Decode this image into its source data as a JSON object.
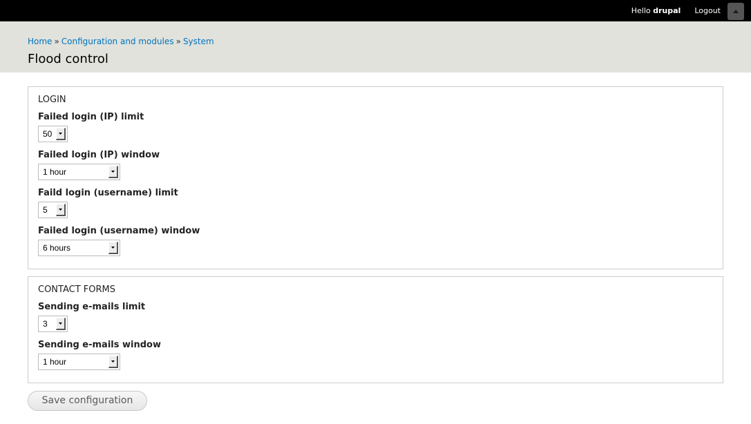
{
  "toolbar": {
    "hello_prefix": "Hello",
    "username": "drupal",
    "logout_label": "Logout"
  },
  "breadcrumb": {
    "items": [
      "Home",
      "Configuration and modules",
      "System"
    ],
    "separator": "»"
  },
  "page": {
    "title": "Flood control"
  },
  "login": {
    "legend": "LOGIN",
    "fields": [
      {
        "label": "Failed login (IP) limit",
        "value": "50"
      },
      {
        "label": "Failed login (IP) window",
        "value": "1 hour"
      },
      {
        "label": "Faild login (username) limit",
        "value": "5"
      },
      {
        "label": "Failed login (username) window",
        "value": "6 hours"
      }
    ]
  },
  "contact": {
    "legend": "CONTACT FORMS",
    "fields": [
      {
        "label": "Sending e-mails limit",
        "value": "3"
      },
      {
        "label": "Sending e-mails window",
        "value": "1 hour"
      }
    ]
  },
  "actions": {
    "save_label": "Save configuration"
  },
  "colors": {
    "toolbar_bg": "#000000",
    "header_bg": "#e1e2dc",
    "link": "#0074bd"
  },
  "icons": {
    "toolbar_toggle": "triangle-up-icon",
    "select_arrow": "triangle-down-icon"
  }
}
